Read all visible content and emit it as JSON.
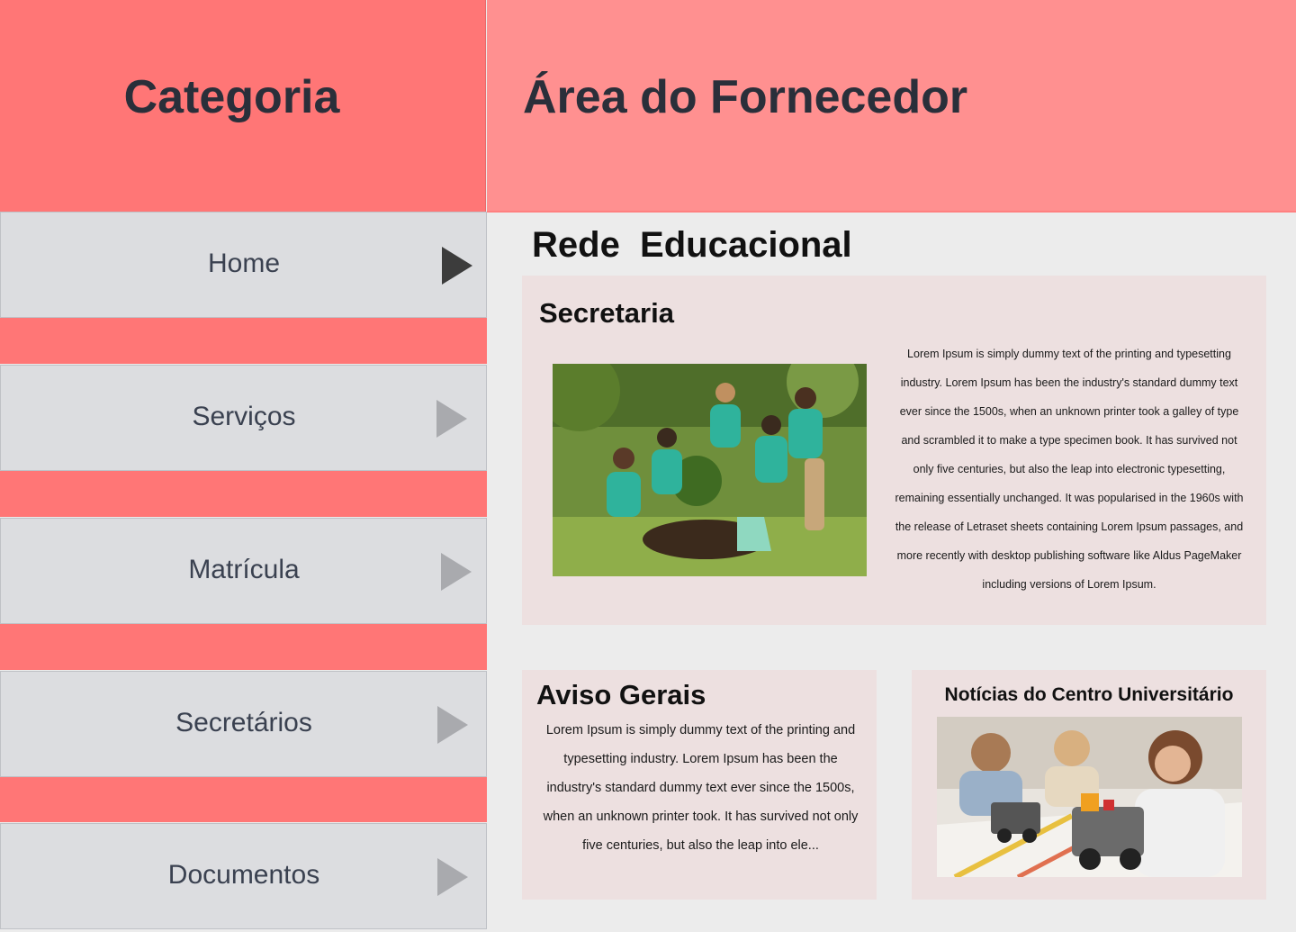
{
  "sidebar": {
    "title": "Categoria",
    "items": [
      {
        "label": "Home",
        "active": true
      },
      {
        "label": "Serviços",
        "active": false
      },
      {
        "label": "Matrícula",
        "active": false
      },
      {
        "label": "Secretários",
        "active": false
      },
      {
        "label": "Documentos",
        "active": false
      }
    ]
  },
  "header": {
    "title": "Área do Fornecedor"
  },
  "main": {
    "section_title": "Rede  Educacional",
    "secretaria": {
      "title": "Secretaria",
      "text": "Lorem Ipsum is simply dummy text of the printing and typesetting industry. Lorem Ipsum has been the industry's standard dummy text ever since the 1500s, when an unknown printer took a galley of type and scrambled it to make a type specimen book. It has survived not only five centuries, but also the leap into electronic typesetting, remaining essentially unchanged. It was popularised in the 1960s with the release of Letraset sheets containing Lorem Ipsum passages, and more recently with desktop publishing software like Aldus PageMaker including versions of Lorem Ipsum."
    },
    "aviso": {
      "title": "Aviso Gerais",
      "text": "Lorem Ipsum is simply dummy text of the printing and typesetting industry. Lorem Ipsum has been the industry's standard dummy text ever since the 1500s, when an unknown printer took. It has survived not only five centuries, but also the leap into ele..."
    },
    "noticias": {
      "title": "Notícias do Centro Universitário"
    }
  },
  "colors": {
    "sidebar_red": "#ff7676",
    "header_pink": "#ff9090",
    "nav_gray": "#dcdde0",
    "card_bg": "#ede0e0",
    "page_bg": "#ececec"
  }
}
